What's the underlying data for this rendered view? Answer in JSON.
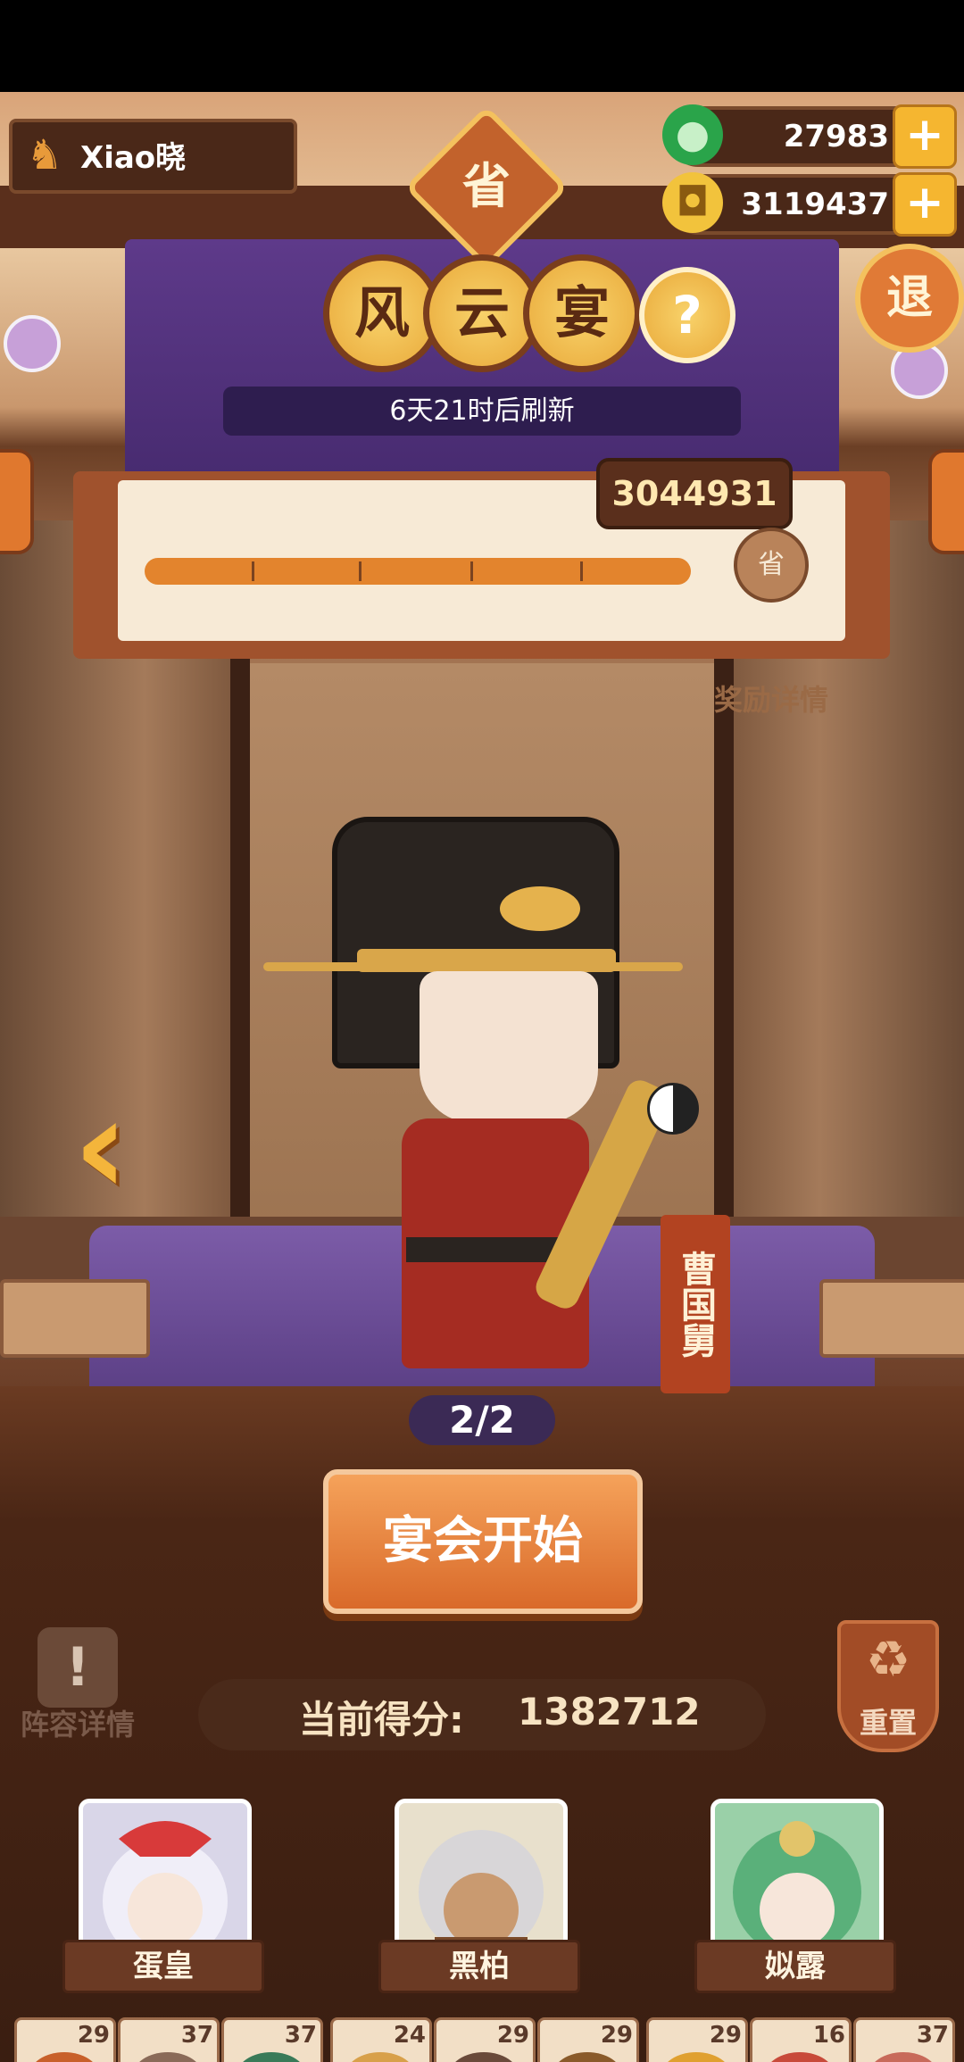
{
  "player": {
    "name": "Xiao晓",
    "icon": "player-avatar-icon"
  },
  "resources": [
    {
      "name": "jade",
      "value": "27983",
      "icon": "jade-icon",
      "color": "#2aa44a"
    },
    {
      "name": "coin",
      "value": "3119437",
      "icon": "coin-icon",
      "color": "#f2c33c"
    }
  ],
  "province_badge": "省",
  "exit_label": "退",
  "event": {
    "title_chars": [
      "风",
      "云",
      "宴"
    ],
    "help_label": "?",
    "refresh_text": "6天21时后刷新",
    "target_score": "3044931",
    "reward_label": "奖励详情",
    "reward_icon_char": "省",
    "progress_fraction": 1.0
  },
  "boss": {
    "name": "曹国舅"
  },
  "page_indicator": "2/2",
  "start_button": "宴会开始",
  "lineup_label": "阵容详情",
  "current_score": {
    "label": "当前得分:",
    "value": "1382712"
  },
  "reset_label": "重置",
  "heroes": [
    {
      "name": "蛋皇",
      "color": "#d9d6e8",
      "hair": "#f0eef8",
      "accent": "#d83a3a"
    },
    {
      "name": "黑柏",
      "color": "#e8e0cc",
      "hair": "#d8d6d8",
      "accent": "#7a4a2a"
    },
    {
      "name": "姒露",
      "color": "#9ad0a8",
      "hair": "#5ab07a",
      "accent": "#e2c46a"
    }
  ],
  "dishes": [
    {
      "count": "29",
      "color": "#c8602a"
    },
    {
      "count": "37",
      "color": "#8a6a58"
    },
    {
      "count": "37",
      "color": "#3a7a58"
    },
    {
      "count": "24",
      "color": "#d8a04a"
    },
    {
      "count": "29",
      "color": "#6a4a3a"
    },
    {
      "count": "29",
      "color": "#8a5a2a"
    },
    {
      "count": "29",
      "color": "#e0a030"
    },
    {
      "count": "16",
      "color": "#c84a3a"
    },
    {
      "count": "37",
      "color": "#c86a5a"
    }
  ]
}
